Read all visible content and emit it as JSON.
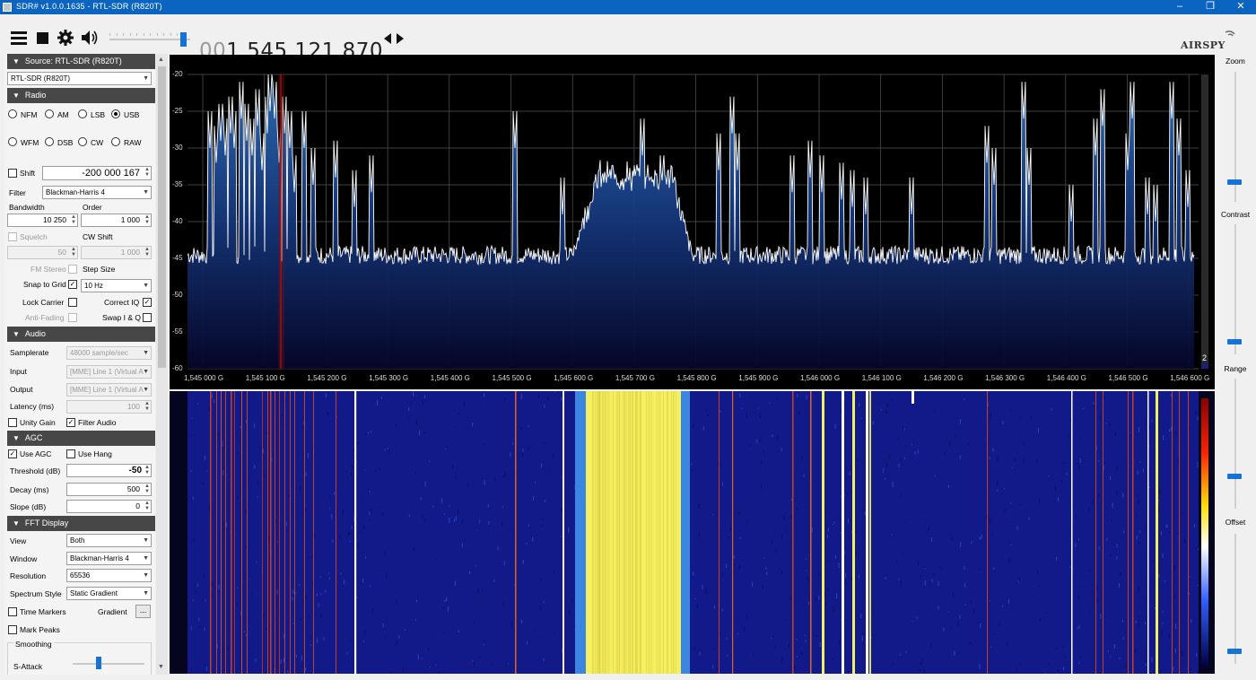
{
  "window": {
    "title": "SDR# v1.0.0.1635 - RTL-SDR (R820T)"
  },
  "toolbar": {
    "freq_dim": "00",
    "freq_main": "1.545.121.870",
    "icons": [
      "menu-icon",
      "stop-icon",
      "gear-icon",
      "speaker-icon",
      "step-arrows-icon"
    ],
    "volume_level": 0.95,
    "logo": "AIRSPY"
  },
  "source": {
    "header": "Source: RTL-SDR (R820T)",
    "device": "RTL-SDR (R820T)"
  },
  "radio": {
    "header": "Radio",
    "modes": [
      "NFM",
      "AM",
      "LSB",
      "USB",
      "WFM",
      "DSB",
      "CW",
      "RAW"
    ],
    "selected": "USB",
    "shift_label": "Shift",
    "shift_value": "-200 000 167",
    "filter_label": "Filter",
    "filter_value": "Blackman-Harris 4",
    "bandwidth_label": "Bandwidth",
    "bandwidth_value": "10 250",
    "order_label": "Order",
    "order_value": "1 000",
    "squelch_label": "Squelch",
    "squelch_value": "50",
    "cwshift_label": "CW Shift",
    "cwshift_value": "1 000",
    "fmstereo_label": "FM Stereo",
    "stepsize_label": "Step Size",
    "snap_label": "Snap to Grid",
    "step_value": "10 Hz",
    "lockcarrier_label": "Lock Carrier",
    "correctiq_label": "Correct IQ",
    "antifading_label": "Anti-Fading",
    "swapiq_label": "Swap I & Q"
  },
  "audio": {
    "header": "Audio",
    "samplerate_label": "Samplerate",
    "samplerate_value": "48000 sample/sec",
    "input_label": "Input",
    "input_value": "[MME] Line 1 (Virtual A",
    "output_label": "Output",
    "output_value": "[MME] Line 1 (Virtual A",
    "latency_label": "Latency (ms)",
    "latency_value": "100",
    "unitygain_label": "Unity Gain",
    "filteraudio_label": "Filter Audio"
  },
  "agc": {
    "header": "AGC",
    "useagc_label": "Use AGC",
    "usehang_label": "Use Hang",
    "threshold_label": "Threshold (dB)",
    "threshold_value": "-50",
    "decay_label": "Decay (ms)",
    "decay_value": "500",
    "slope_label": "Slope (dB)",
    "slope_value": "0"
  },
  "fft": {
    "header": "FFT Display",
    "view_label": "View",
    "view_value": "Both",
    "window_label": "Window",
    "window_value": "Blackman-Harris 4",
    "resolution_label": "Resolution",
    "resolution_value": "65536",
    "style_label": "Spectrum Style",
    "style_value": "Static Gradient",
    "timemarkers_label": "Time Markers",
    "gradient_label": "Gradient",
    "gradient_btn": "...",
    "markpeaks_label": "Mark Peaks",
    "smoothing_label": "Smoothing",
    "sattack_label": "S-Attack"
  },
  "right": {
    "zoom_label": "Zoom",
    "contrast_label": "Contrast",
    "range_label": "Range",
    "offset_label": "Offset",
    "zoom_level": 0.15,
    "contrast_level": 0.1,
    "range_level": 0.25,
    "offset_level": 0.1
  },
  "spectrum_axis": {
    "y_ticks": [
      "-20",
      "-25",
      "-30",
      "-35",
      "-40",
      "-45",
      "-50",
      "-55",
      "-60"
    ],
    "x_ticks": [
      "1,545 000 G",
      "1,545 100 G",
      "1,545 200 G",
      "1,545 300 G",
      "1,545 400 G",
      "1,545 500 G",
      "1,545 600 G",
      "1,545 700 G",
      "1,545 800 G",
      "1,545 900 G",
      "1,546 000 G",
      "1,546 100 G",
      "1,546 200 G",
      "1,546 300 G",
      "1,546 400 G",
      "1,546 500 G",
      "1,546 600 G"
    ],
    "corner_value": "2"
  },
  "colors": {
    "accent": "#1673d4",
    "title_bar": "#0a64c0",
    "section_header": "#474747",
    "trace": "#ffffff",
    "fill_top": "#2e6fb8",
    "tuned_marker": "#b01010"
  }
}
